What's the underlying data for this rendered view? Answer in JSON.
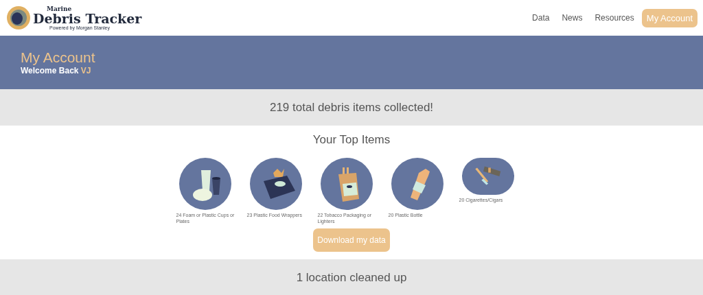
{
  "logo": {
    "small": "Marine",
    "title": "Debris Tracker",
    "tagline": "Powered by Morgan Stanley"
  },
  "nav": [
    {
      "label": "Data",
      "selected": false
    },
    {
      "label": "News",
      "selected": false
    },
    {
      "label": "Resources",
      "selected": false
    },
    {
      "label": "My Account",
      "selected": true
    }
  ],
  "banner": {
    "title": "My Account",
    "welcome": "Welcome Back",
    "user": "VJ"
  },
  "total": "219 total debris items collected!",
  "top_items": {
    "title": "Your Top Items",
    "items": [
      {
        "kind": "cups",
        "caption": "24 Foam or Plastic Cups or Plates"
      },
      {
        "kind": "wrapper",
        "caption": "23 Plastic Food Wrappers"
      },
      {
        "kind": "tobacco",
        "caption": "22 Tobacco Packaging or Lighters"
      },
      {
        "kind": "bottle",
        "caption": "20 Plastic Bottle"
      },
      {
        "kind": "cigarettes",
        "caption": "20 Cigarettes/Cigars"
      }
    ]
  },
  "download_button": "Download my data",
  "locations": "1 location cleaned up"
}
